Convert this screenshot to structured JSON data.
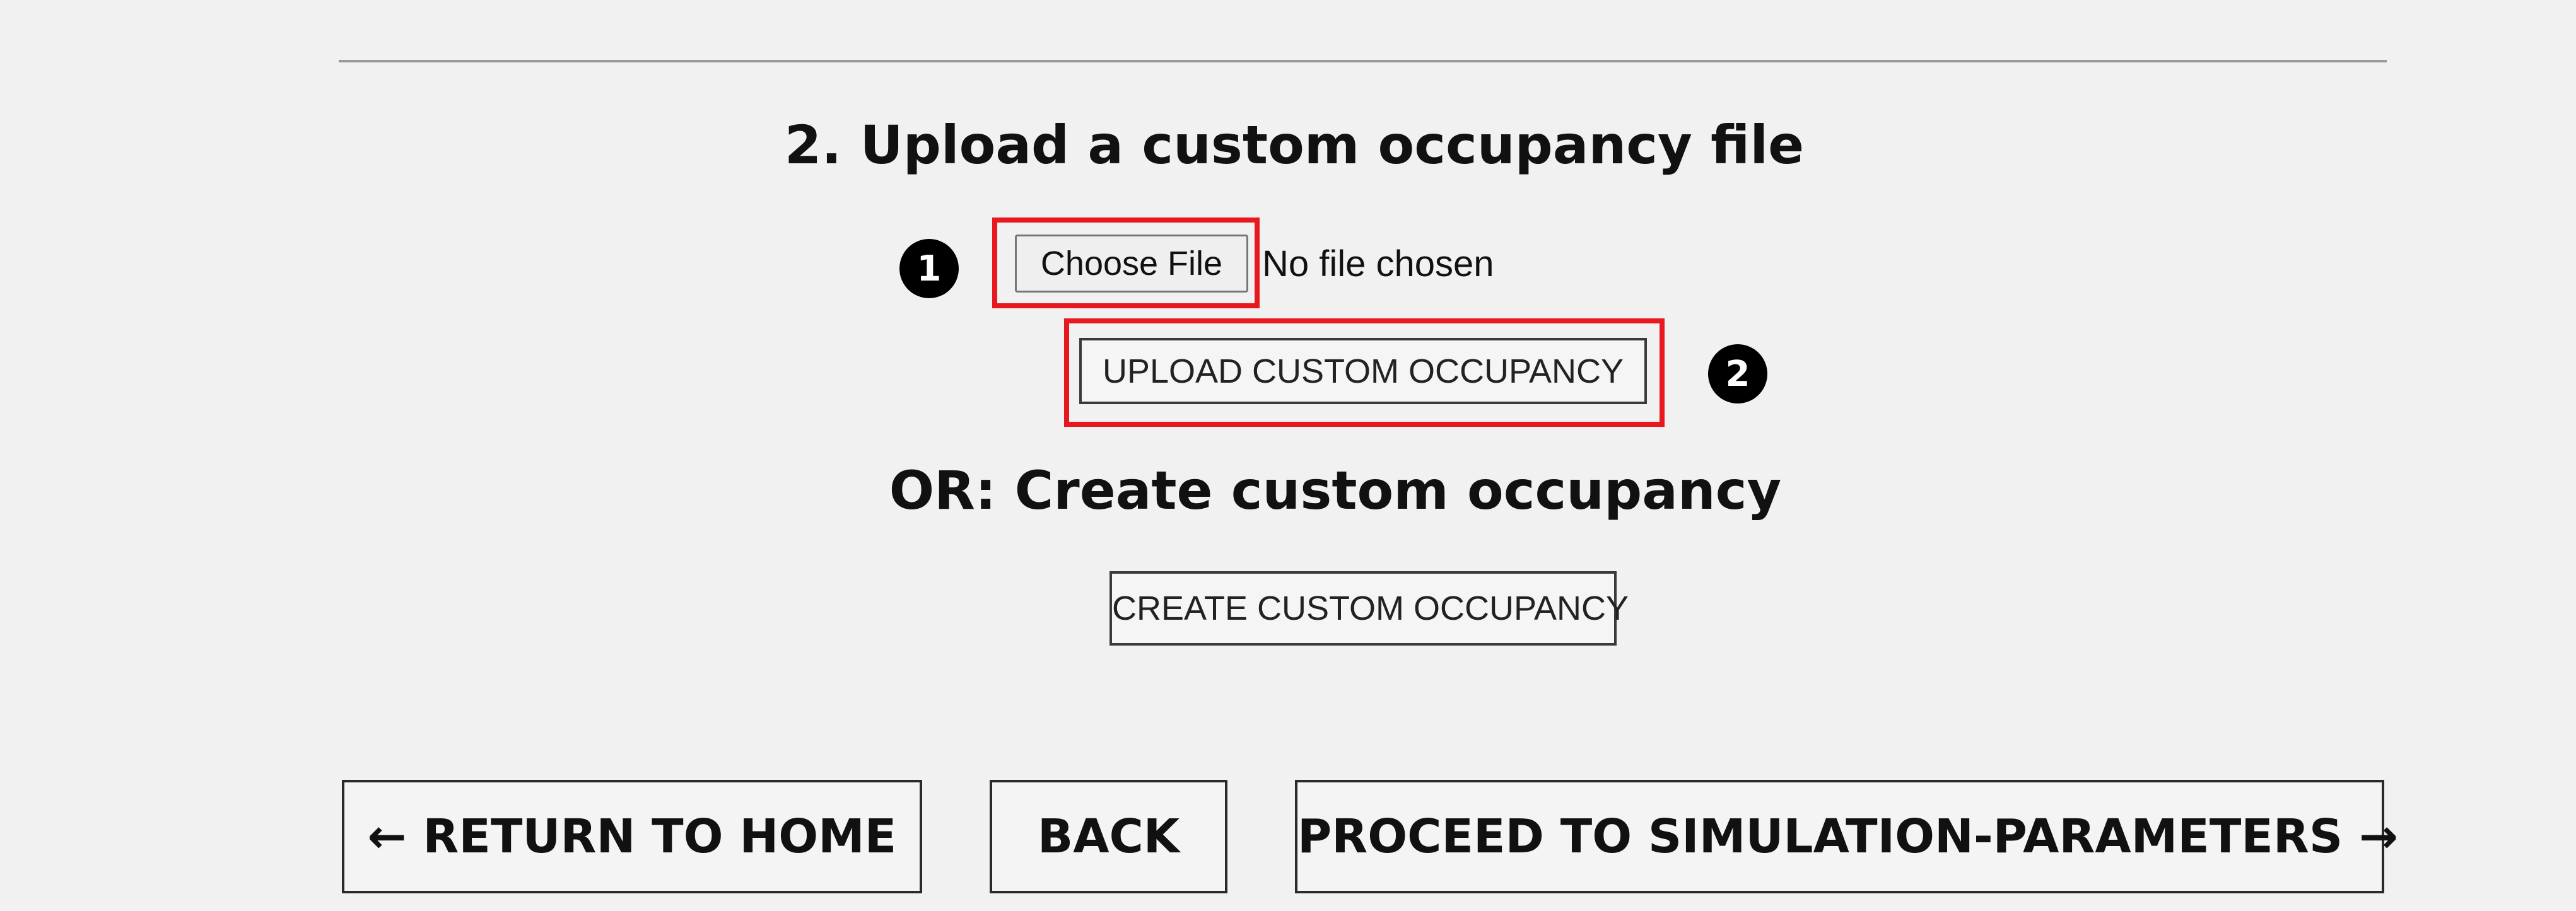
{
  "upload_section": {
    "title": "2. Upload a custom occupancy file",
    "choose_file_label": "Choose File",
    "file_status": "No file chosen",
    "upload_button_label": "UPLOAD CUSTOM OCCUPANCY"
  },
  "create_section": {
    "title": "OR: Create custom occupancy",
    "create_button_label": "CREATE CUSTOM OCCUPANCY"
  },
  "navigation": {
    "home_label": "← RETURN TO HOME",
    "back_label": "BACK",
    "proceed_label": "PROCEED TO SIMULATION-PARAMETERS →"
  },
  "annotations": {
    "step_1": "1",
    "step_2": "2",
    "highlight_color": "#e8191e"
  }
}
